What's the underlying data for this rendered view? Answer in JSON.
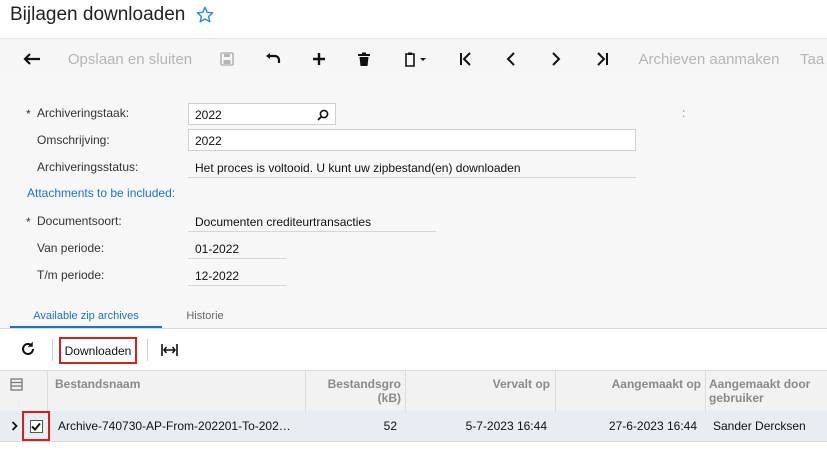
{
  "header": {
    "title": "Bijlagen downloaden",
    "star_icon": "star-icon"
  },
  "toolbar": {
    "back_icon": "arrow-left-icon",
    "save_close_label": "Opslaan en sluiten",
    "save_icon": "floppy-icon",
    "undo_icon": "undo-icon",
    "add_icon": "plus-icon",
    "delete_icon": "trash-icon",
    "copy_paste_icon": "clipboard-icon",
    "first_icon": "first-record-icon",
    "prev_icon": "chevron-left-icon",
    "next_icon": "chevron-right-icon",
    "last_icon": "last-record-icon",
    "create_archives_label": "Archieven aanmaken",
    "truncated_label": "Taa"
  },
  "form": {
    "archiveringstaak_label": "Archiveringstaak:",
    "archiveringstaak_value": "2022",
    "omschrijving_label": "Omschrijving:",
    "omschrijving_value": "2022",
    "status_label": "Archiveringsstatus:",
    "status_value": "Het proces is voltooid. U kunt uw zipbestand(en) downloaden",
    "attachments_label": "Attachments to be included:",
    "documentsoort_label": "Documentsoort:",
    "documentsoort_value": "Documenten crediteurtransacties",
    "van_periode_label": "Van periode:",
    "van_periode_value": "01-2022",
    "tm_periode_label": "T/m periode:",
    "tm_periode_value": "12-2022",
    "required_mark": "*",
    "colon_mark": ":"
  },
  "tabs": [
    {
      "label": "Available zip archives",
      "active": true
    },
    {
      "label": "Historie",
      "active": false
    }
  ],
  "grid_toolbar": {
    "refresh_icon": "refresh-icon",
    "download_label": "Downloaden",
    "fit_icon": "fit-width-icon"
  },
  "grid": {
    "columns": [
      "Bestandsnaam",
      "Bestandsgro (kB)",
      "Vervalt op",
      "Aangemaakt op",
      "Aangemaakt door gebruiker"
    ],
    "rows": [
      {
        "selected": true,
        "bestandsnaam": "Archive-740730-AP-From-202201-To-202…",
        "grootte": "52",
        "vervalt_op": "5-7-2023 16:44",
        "aangemaakt_op": "27-6-2023 16:44",
        "gebruiker": "Sander Dercksen"
      }
    ]
  },
  "colors": {
    "accent": "#1a73c9",
    "highlight": "#d62020",
    "disabled": "#b5b5b5"
  }
}
